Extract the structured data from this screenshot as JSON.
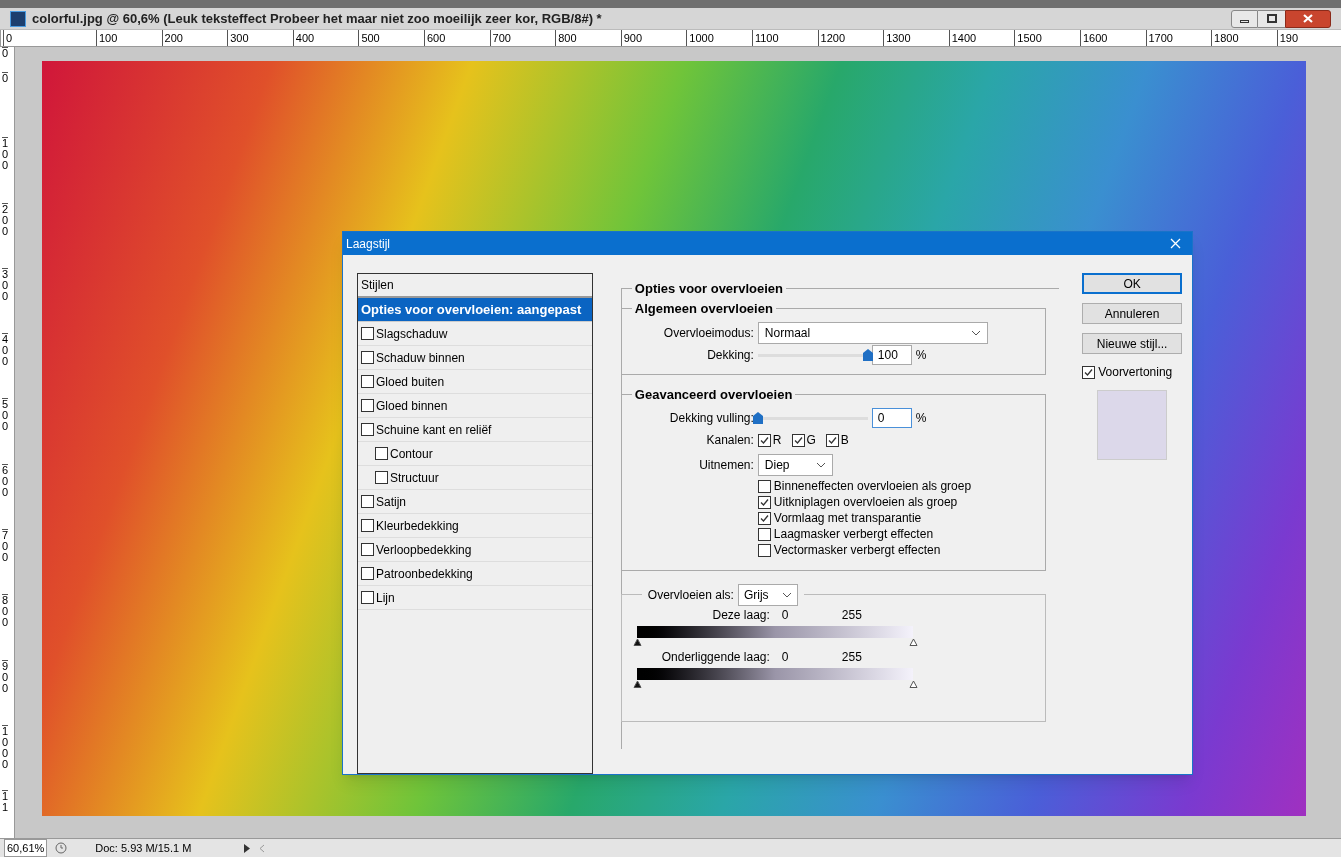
{
  "window": {
    "title": "colorful.jpg @ 60,6% (Leuk teksteffect  Probeer het maar  niet zoo moeilijk  zeer kor, RGB/8#) *"
  },
  "ruler_h": [
    "0",
    "100",
    "200",
    "300",
    "400",
    "500",
    "600",
    "700",
    "800",
    "900",
    "1000",
    "1100",
    "1200",
    "1300",
    "1400",
    "1500",
    "1600",
    "1700",
    "1800",
    "190"
  ],
  "ruler_v": [
    "0",
    "0",
    "100",
    "200",
    "300",
    "400",
    "500",
    "600",
    "700",
    "800",
    "900",
    "1000",
    "11"
  ],
  "dialog": {
    "title": "Laagstijl",
    "styles_header": "Stijlen",
    "styles": [
      {
        "label": "Opties voor overvloeien: aangepast",
        "kind": "header",
        "selected": true
      },
      {
        "label": "Slagschaduw",
        "kind": "check",
        "checked": false,
        "selected": false
      },
      {
        "label": "Schaduw binnen",
        "kind": "check",
        "checked": false,
        "selected": false
      },
      {
        "label": "Gloed buiten",
        "kind": "check",
        "checked": false,
        "selected": false
      },
      {
        "label": "Gloed binnen",
        "kind": "check",
        "checked": false,
        "selected": false
      },
      {
        "label": "Schuine kant en reliëf",
        "kind": "check",
        "checked": false,
        "selected": false,
        "children": [
          {
            "label": "Contour",
            "kind": "check",
            "checked": false,
            "selected": false
          },
          {
            "label": "Structuur",
            "kind": "check",
            "checked": false,
            "selected": false
          }
        ]
      },
      {
        "label": "Satijn",
        "kind": "check",
        "checked": false,
        "selected": false
      },
      {
        "label": "Kleurbedekking",
        "kind": "check",
        "checked": false,
        "selected": false
      },
      {
        "label": "Verloopbedekking",
        "kind": "check",
        "checked": false,
        "selected": false
      },
      {
        "label": "Patroonbedekking",
        "kind": "check",
        "checked": false,
        "selected": false
      },
      {
        "label": "Lijn",
        "kind": "check",
        "checked": false,
        "selected": false
      }
    ],
    "section_title": "Opties voor overvloeien",
    "general": {
      "title": "Algemeen overvloeien",
      "mode_label": "Overvloeimodus:",
      "mode_value": "Normaal",
      "opacity_label": "Dekking:",
      "opacity": {
        "level": 1,
        "value": "100",
        "unit": "%"
      }
    },
    "advanced": {
      "title": "Geavanceerd overvloeien",
      "fill_label": "Dekking vulling:",
      "fill": {
        "level": 0,
        "value": "0",
        "unit": "%"
      },
      "channels_label": "Kanalen:",
      "channels": [
        {
          "label": "R",
          "checked": true
        },
        {
          "label": "G",
          "checked": true
        },
        {
          "label": "B",
          "checked": true
        }
      ],
      "knockout_label": "Uitnemen:",
      "knockout_value": "Diep",
      "options": [
        {
          "label": "Binneneffecten overvloeien als groep",
          "checked": false
        },
        {
          "label": "Uitkniplagen overvloeien als groep",
          "checked": true
        },
        {
          "label": "Vormlaag met transparantie",
          "checked": true
        },
        {
          "label": "Laagmasker verbergt effecten",
          "checked": false
        },
        {
          "label": "Vectormasker verbergt effecten",
          "checked": false
        }
      ]
    },
    "blend_if": {
      "label": "Overvloeien als:",
      "value": "Grijs",
      "ranges": [
        {
          "label": "Deze laag:",
          "low": "0",
          "high": "255",
          "thumbs": [
            {
              "level": 0
            },
            {
              "level": 1
            }
          ]
        },
        {
          "label": "Onderliggende laag:",
          "low": "0",
          "high": "255",
          "thumbs": [
            {
              "level": 0
            },
            {
              "level": 1
            }
          ]
        }
      ]
    },
    "buttons": [
      {
        "label": "OK",
        "default": true
      },
      {
        "label": "Annuleren",
        "default": false
      },
      {
        "label": "Nieuwe stijl...",
        "default": false
      }
    ],
    "preview": {
      "label": "Voorvertoning",
      "checked": true
    }
  },
  "status_bar": {
    "zoom": "60,61%",
    "doc": "Doc: 5.93 M/15.1 M"
  }
}
